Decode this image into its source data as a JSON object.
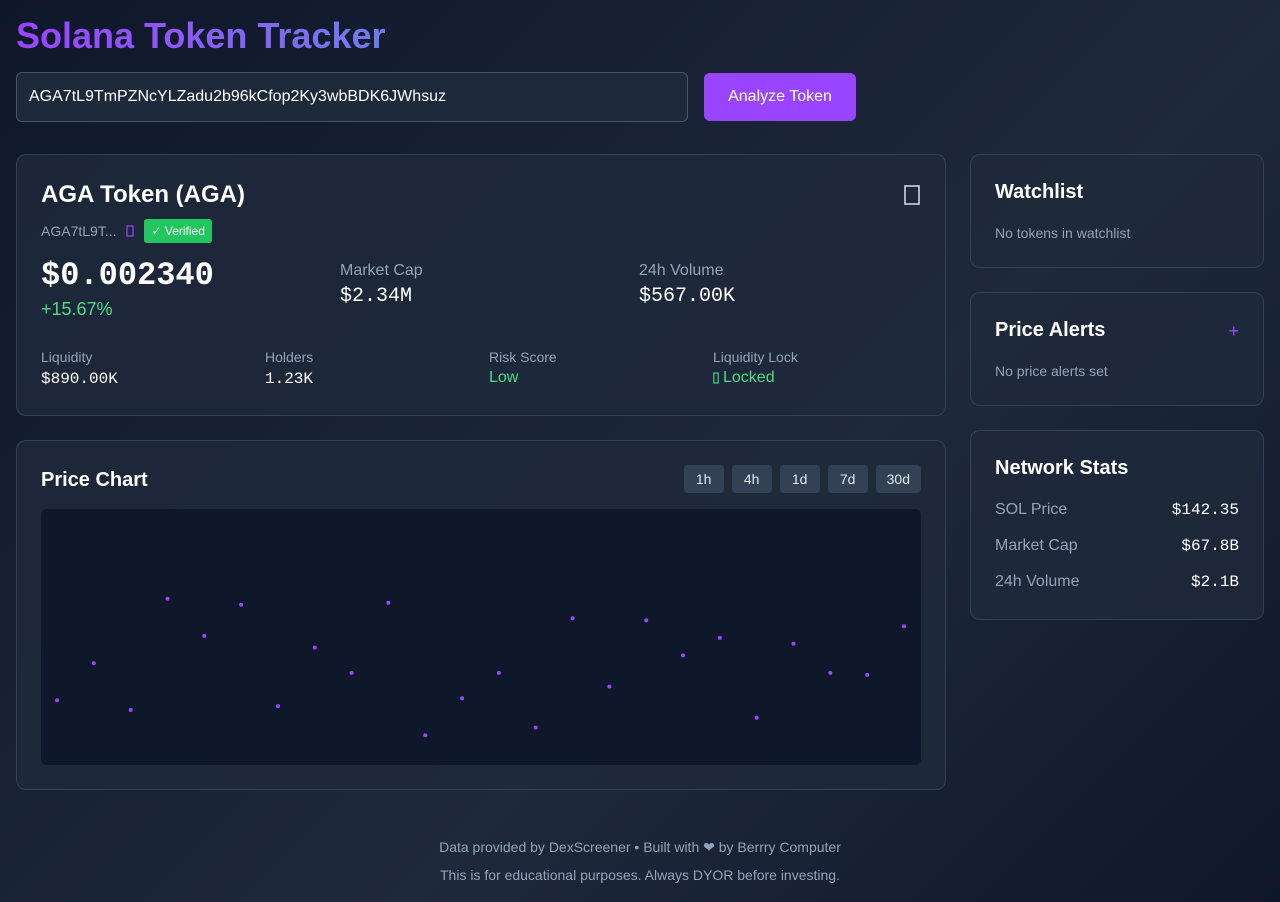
{
  "header": {
    "title": "Solana Token Tracker",
    "search_value": "AGA7tL9TmPZNcYLZadu2b96kCfop2Ky3wbBDK6JWhsuz",
    "analyze_label": "Analyze Token"
  },
  "token": {
    "name": "AGA Token (AGA)",
    "short_address": "AGA7tL9T...",
    "verified_label": "✓ Verified",
    "price": "$0.002340",
    "change": "+15.67%",
    "market_cap_label": "Market Cap",
    "market_cap": "$2.34M",
    "volume_label": "24h Volume",
    "volume": "$567.00K",
    "liquidity_label": "Liquidity",
    "liquidity": "$890.00K",
    "holders_label": "Holders",
    "holders": "1.23K",
    "risk_label": "Risk Score",
    "risk": "Low",
    "lock_label": "Liquidity Lock",
    "lock_status": "Locked"
  },
  "price_chart": {
    "title": "Price Chart",
    "timeframes": [
      "1h",
      "4h",
      "1d",
      "7d",
      "30d"
    ]
  },
  "chart_data": {
    "type": "scatter",
    "title": "Price Chart",
    "xlabel": "",
    "ylabel": "",
    "x": [
      0,
      1,
      2,
      3,
      4,
      5,
      6,
      7,
      8,
      9,
      10,
      11,
      12,
      13,
      14,
      15,
      16,
      17,
      18,
      19,
      20,
      21,
      22,
      23
    ],
    "values": [
      0.25,
      0.44,
      0.2,
      0.77,
      0.58,
      0.74,
      0.22,
      0.52,
      0.39,
      0.75,
      0.07,
      0.26,
      0.39,
      0.11,
      0.67,
      0.32,
      0.66,
      0.48,
      0.57,
      0.16,
      0.54,
      0.39,
      0.38,
      0.63
    ],
    "ylim": [
      0,
      1
    ],
    "grid": false,
    "color": "#9945ff"
  },
  "watchlist": {
    "title": "Watchlist",
    "empty_text": "No tokens in watchlist"
  },
  "alerts": {
    "title": "Price Alerts",
    "add_label": "+",
    "empty_text": "No price alerts set"
  },
  "network": {
    "title": "Network Stats",
    "rows": [
      {
        "label": "SOL Price",
        "value": "$142.35"
      },
      {
        "label": "Market Cap",
        "value": "$67.8B"
      },
      {
        "label": "24h Volume",
        "value": "$2.1B"
      }
    ]
  },
  "footer": {
    "line1": "Data provided by DexScreener • Built with ❤ by Berrry Computer",
    "line2": "This is for educational purposes. Always DYOR before investing."
  },
  "colors": {
    "accent": "#9945ff",
    "positive": "#4ade80",
    "verified": "#22c55e"
  },
  "icons": {
    "watchlist_toggle": "star-icon",
    "copy_address": "copy-icon",
    "lock": "lock-icon"
  }
}
